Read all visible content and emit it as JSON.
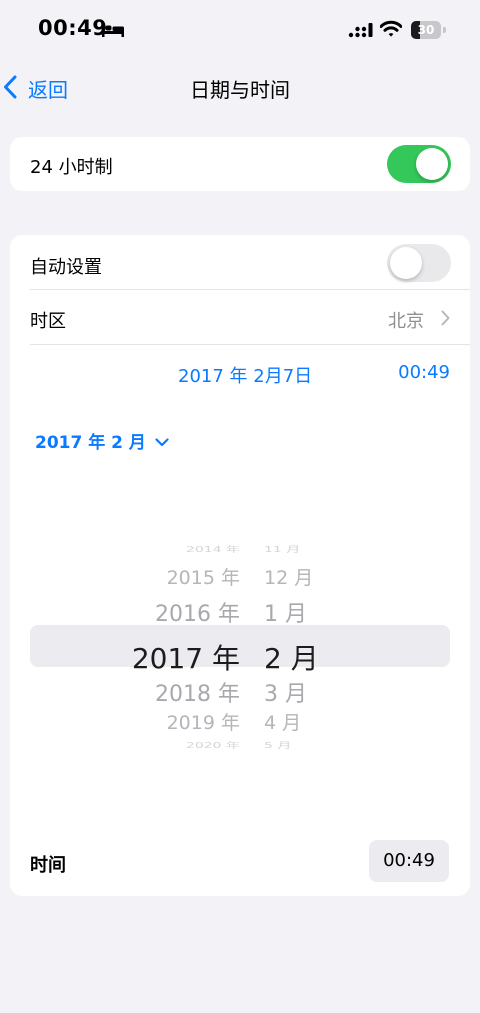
{
  "status_bar": {
    "time": "00:49",
    "battery_level": "30",
    "battery_fraction": 0.3,
    "icons": [
      "bed-icon",
      "cellular-signal-icon",
      "wifi-icon",
      "battery-icon"
    ]
  },
  "nav": {
    "back_label": "返回",
    "title": "日期与时间",
    "back_icon": "chevron-left-icon"
  },
  "colors": {
    "accent": "#0a7aff",
    "toggle_on": "#34c759",
    "background": "#f2f2f7"
  },
  "settings": {
    "clock_24h": {
      "label": "24 小时制",
      "on": true
    },
    "auto_set": {
      "label": "自动设置",
      "on": false
    },
    "timezone": {
      "label": "时区",
      "value": "北京",
      "icon": "chevron-right-icon"
    },
    "date_value": "2017 年 2月7日",
    "time_value": "00:49",
    "month_selector": "2017 年 2 月",
    "time_label": "时间",
    "time_pill": "00:49"
  },
  "picker": {
    "rows": [
      {
        "year": "2014 年",
        "month": "11 月"
      },
      {
        "year": "2015 年",
        "month": "12 月"
      },
      {
        "year": "2016 年",
        "month": "1 月"
      },
      {
        "year": "2017 年",
        "month": "2 月"
      },
      {
        "year": "2018 年",
        "month": "3 月"
      },
      {
        "year": "2019 年",
        "month": "4 月"
      },
      {
        "year": "2020 年",
        "month": "5 月"
      }
    ],
    "selected_index": 3
  }
}
